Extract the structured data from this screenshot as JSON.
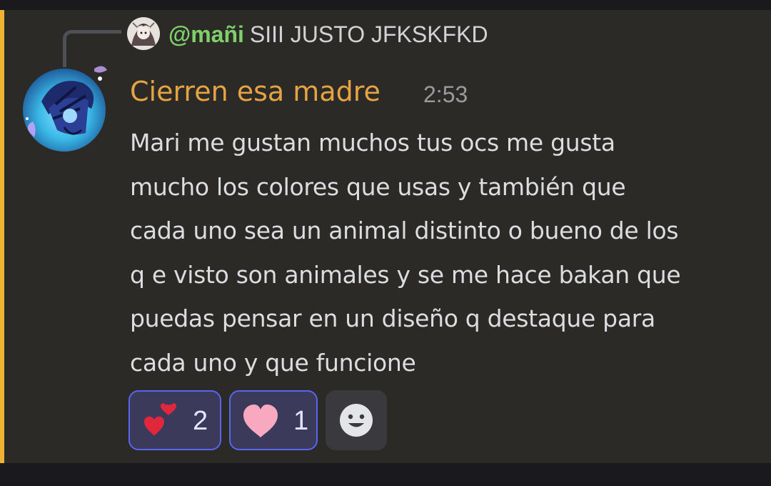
{
  "reply": {
    "username": "@mañi",
    "text": "SIII JUSTO JFKSKFKD"
  },
  "message": {
    "author": "Cierren esa madre",
    "timestamp": "2:53",
    "lines": [
      "Mari me gustan muchos tus ocs me gusta",
      "mucho los colores que usas y también que",
      "cada uno sea un animal distinto o bueno de los",
      "q e visto son animales y se me hace bakan que",
      "puedas pensar en un diseño q destaque para",
      "cada uno y que funcione"
    ]
  },
  "reactions": [
    {
      "emoji": "two-hearts-icon",
      "count": "2"
    },
    {
      "emoji": "pink-heart-icon",
      "count": "1"
    }
  ],
  "colors": {
    "mention_bar": "#f0b232",
    "author": "#e5a343",
    "reply_user": "#7fcf6a",
    "reaction_border": "#5865f2"
  }
}
